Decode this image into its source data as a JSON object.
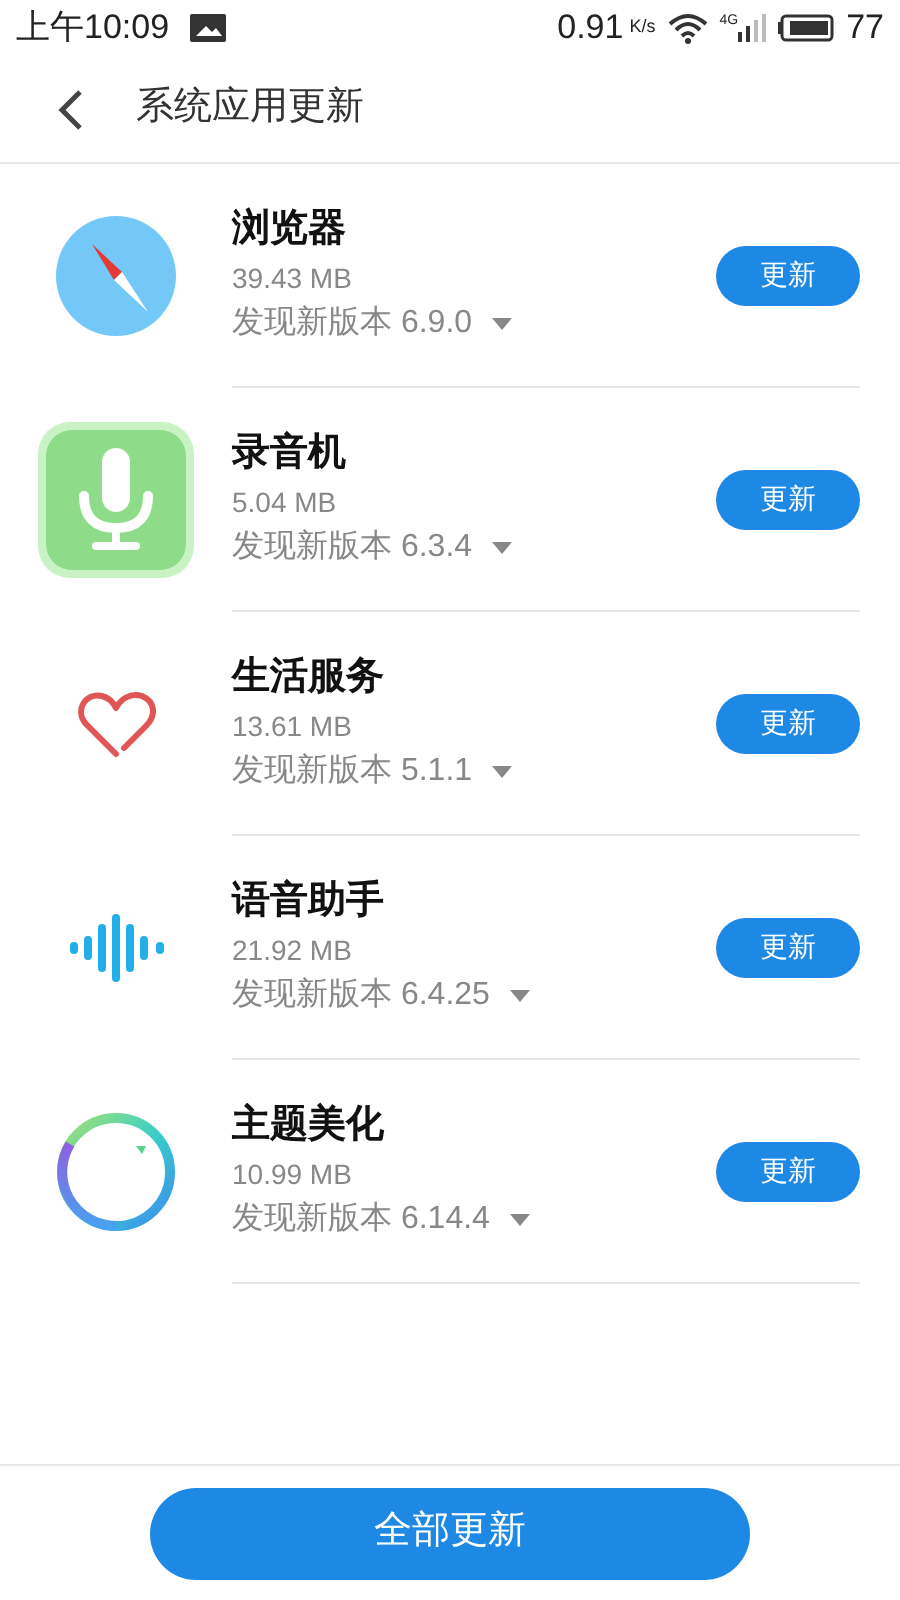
{
  "status_bar": {
    "time": "上午10:09",
    "speed": "0.91",
    "speed_unit": "K/s",
    "network": "4G",
    "battery": "77"
  },
  "header": {
    "title": "系统应用更新"
  },
  "apps": [
    {
      "kind": "compass",
      "name": "浏览器",
      "size": "39.43 MB",
      "version": "发现新版本 6.9.0",
      "button": "更新"
    },
    {
      "kind": "mic",
      "name": "录音机",
      "size": "5.04 MB",
      "version": "发现新版本 6.3.4",
      "button": "更新"
    },
    {
      "kind": "heart",
      "name": "生活服务",
      "size": "13.61 MB",
      "version": "发现新版本 5.1.1",
      "button": "更新"
    },
    {
      "kind": "wave",
      "name": "语音助手",
      "size": "21.92 MB",
      "version": "发现新版本 6.4.25",
      "button": "更新"
    },
    {
      "kind": "ring",
      "name": "主题美化",
      "size": "10.99 MB",
      "version": "发现新版本 6.14.4",
      "button": "更新"
    }
  ],
  "footer": {
    "button": "全部更新"
  }
}
